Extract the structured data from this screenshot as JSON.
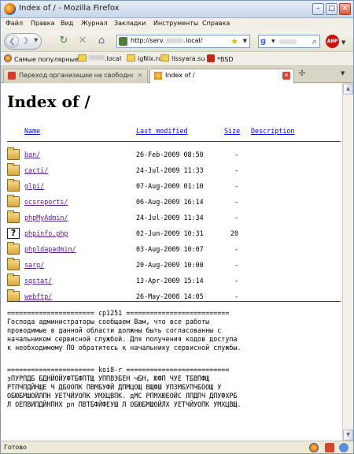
{
  "window": {
    "title": "Index of / - Mozilla Firefox",
    "minimize": "–",
    "maximize": "□",
    "close": "✕"
  },
  "menu": [
    "Файл",
    "Правка",
    "Вид",
    "Журнал",
    "Закладки",
    "Инструменты",
    "Справка"
  ],
  "nav": {
    "url": "http://serv.",
    "url_suffix": ".local/",
    "search_engine": "g"
  },
  "bookmarks": [
    {
      "label": "Самые популярные",
      "icon": "firefox-icon"
    },
    {
      "label": ".local",
      "icon": "folder-icon",
      "blurred_prefix": true
    },
    {
      "label": "igNix.ru",
      "icon": "folder-icon"
    },
    {
      "label": "lissyara.su",
      "icon": "folder-icon"
    },
    {
      "label": "*BSD",
      "icon": "daemon-icon"
    }
  ],
  "tabs": [
    {
      "label": "Переход организации на свободное ...",
      "active": false
    },
    {
      "label": "Index of /",
      "active": true
    }
  ],
  "page": {
    "heading": "Index of /",
    "columns": {
      "name": "Name",
      "modified": "Last modified",
      "size": "Size",
      "description": "Description"
    },
    "entries": [
      {
        "name": "ban/",
        "modified": "26-Feb-2009 08:50",
        "size": "-",
        "icon": "folder-icon"
      },
      {
        "name": "cacti/",
        "modified": "24-Jul-2009 11:33",
        "size": "-",
        "icon": "folder-icon"
      },
      {
        "name": "glpi/",
        "modified": "07-Aug-2009 01:10",
        "size": "-",
        "icon": "folder-icon"
      },
      {
        "name": "ocsreports/",
        "modified": "06-Aug-2009 16:14",
        "size": "-",
        "icon": "folder-icon"
      },
      {
        "name": "phpMyAdmin/",
        "modified": "24-Jul-2009 11:34",
        "size": "-",
        "icon": "folder-icon"
      },
      {
        "name": "phpinfo.php",
        "modified": "02-Jun-2009 10:31",
        "size": "20",
        "icon": "unknown-file-icon"
      },
      {
        "name": "phpldapadmin/",
        "modified": "03-Aug-2009 10:07",
        "size": "-",
        "icon": "folder-icon"
      },
      {
        "name": "sarg/",
        "modified": "20-Aug-2009 10:00",
        "size": "-",
        "icon": "folder-icon"
      },
      {
        "name": "sqstat/",
        "modified": "13-Apr-2009 15:14",
        "size": "-",
        "icon": "folder-icon"
      },
      {
        "name": "webftp/",
        "modified": "26-May-2008 14:05",
        "size": "-",
        "icon": "folder-icon"
      }
    ],
    "readme_cp1251": "====================== cp1251 ==========================\nГоспода администраторы сообщаем Вам, что все работы\nпроводимые в данной области должны быть согласованны с\nначальником сервисной службой. Для получения кодов доступа\nк необходимому ПО обратитесь к начальнику сервисной службы.",
    "readme_koi8r": "====================== koi8-r ==========================\nзПУРПДБ БДНЙОЙУФТБФПТЩ УППВЭБЕН чБН, ЮФП ЧУЕ ТБВПФЩ\nРТПЧПДЙНЩЕ Ч ДБООПК ПВМБУФЙ ДПМЦОЩ ВЩФШ УПЗМБУПЧБООЩ У\nОБЮБМШОЙЛПН УЕТЧЙУОПК УМХЦВПК. дМС РПМХЮЕОЙС ЛПДПЧ ДПУФХРБ\nЛ ОЕПВИПДЙНПНХ рп ПВТБФЙФЕУШ Л ОБЮБМШОЙЛХ УЕТЧЙУОПК УМХЦВЩ."
  },
  "status": {
    "text": "Готово"
  }
}
